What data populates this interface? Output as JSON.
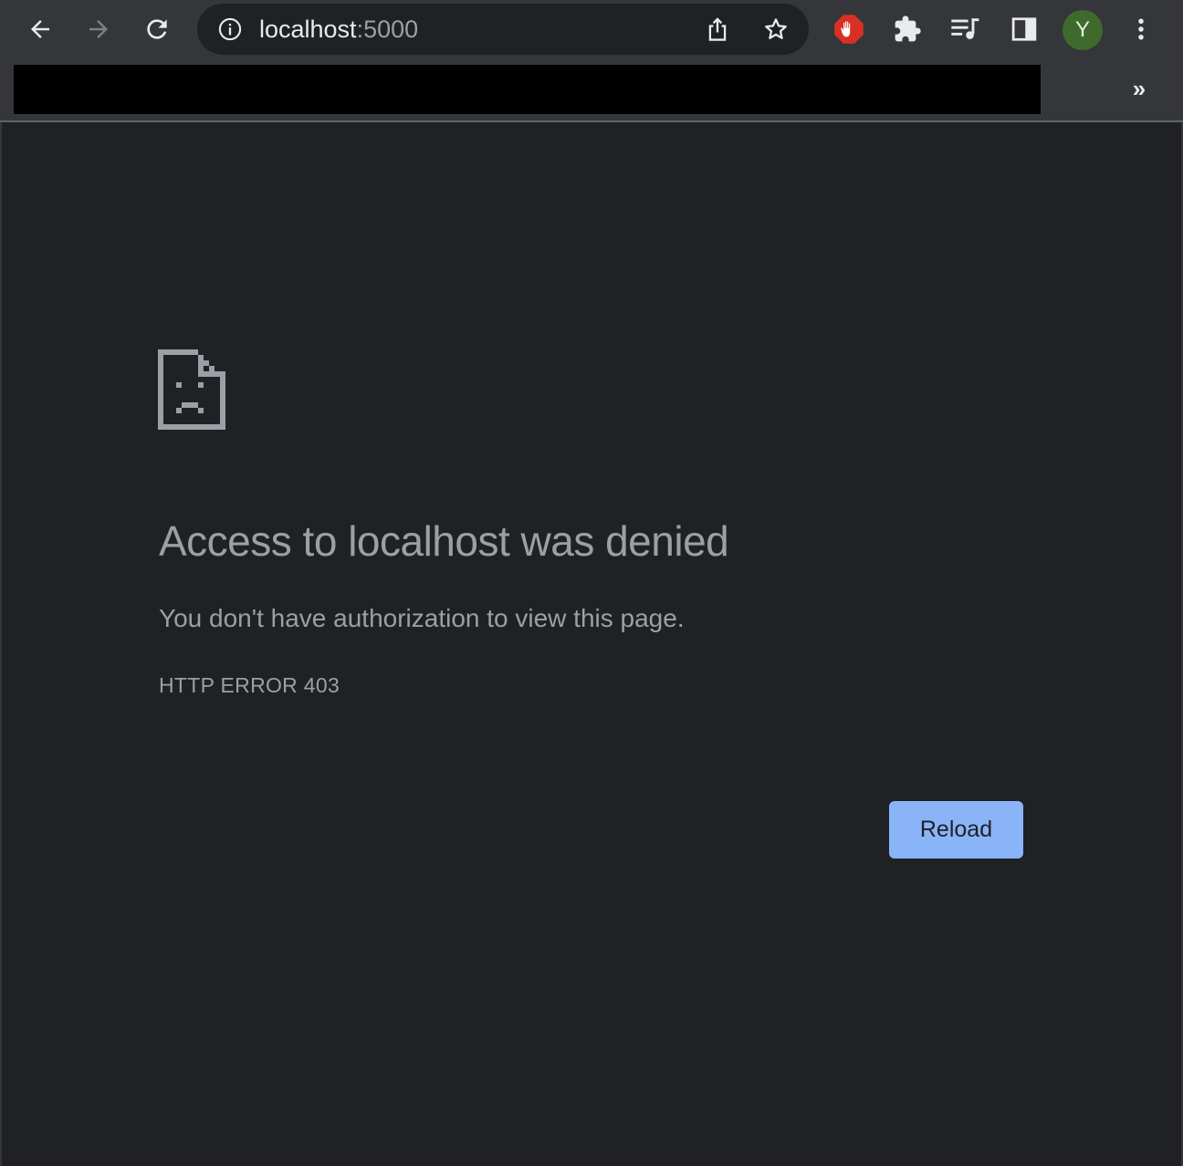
{
  "browser": {
    "toolbar": {
      "back_label": "Back",
      "forward_label": "Forward",
      "reload_label": "Reload page"
    },
    "omnibox": {
      "host": "localhost",
      "port": ":5000"
    },
    "profile": {
      "initial": "Y",
      "color": "#3e6b2c"
    },
    "bookmarks": {
      "overflow_label": "»"
    },
    "icons": [
      "back-arrow-icon",
      "forward-arrow-icon",
      "reload-icon",
      "site-info-icon",
      "share-icon",
      "bookmark-star-icon",
      "adblock-hand-icon",
      "extensions-puzzle-icon",
      "media-queue-icon",
      "side-panel-icon",
      "more-vert-icon"
    ]
  },
  "page": {
    "title": "Access to localhost was denied",
    "description": "You don't have authorization to view this page.",
    "error_code": "HTTP ERROR 403",
    "reload_button": "Reload",
    "accent_color": "#8ab4f8",
    "background_color": "#202124",
    "text_color": "#9aa0a6"
  }
}
